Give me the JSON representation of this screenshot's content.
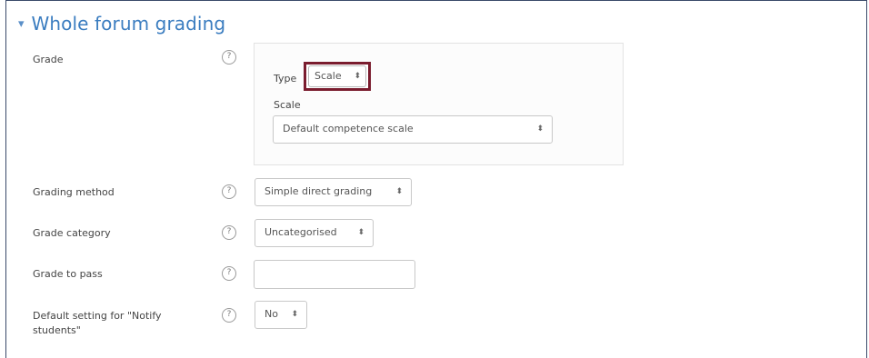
{
  "section": {
    "title": "Whole forum grading",
    "caret": "▾"
  },
  "fields": {
    "grade": {
      "label": "Grade",
      "type_label": "Type",
      "type_value": "Scale",
      "scale_label": "Scale",
      "scale_value": "Default competence scale"
    },
    "grading_method": {
      "label": "Grading method",
      "value": "Simple direct grading"
    },
    "grade_category": {
      "label": "Grade category",
      "value": "Uncategorised"
    },
    "grade_to_pass": {
      "label": "Grade to pass",
      "value": ""
    },
    "notify": {
      "label_line1": "Default setting for \"Notify",
      "label_line2": "students\"",
      "value": "No"
    }
  },
  "icons": {
    "help": "?",
    "select_arrow": "⬍"
  },
  "colors": {
    "title": "#3b7dc0",
    "highlight_border": "#7a1c2e"
  }
}
